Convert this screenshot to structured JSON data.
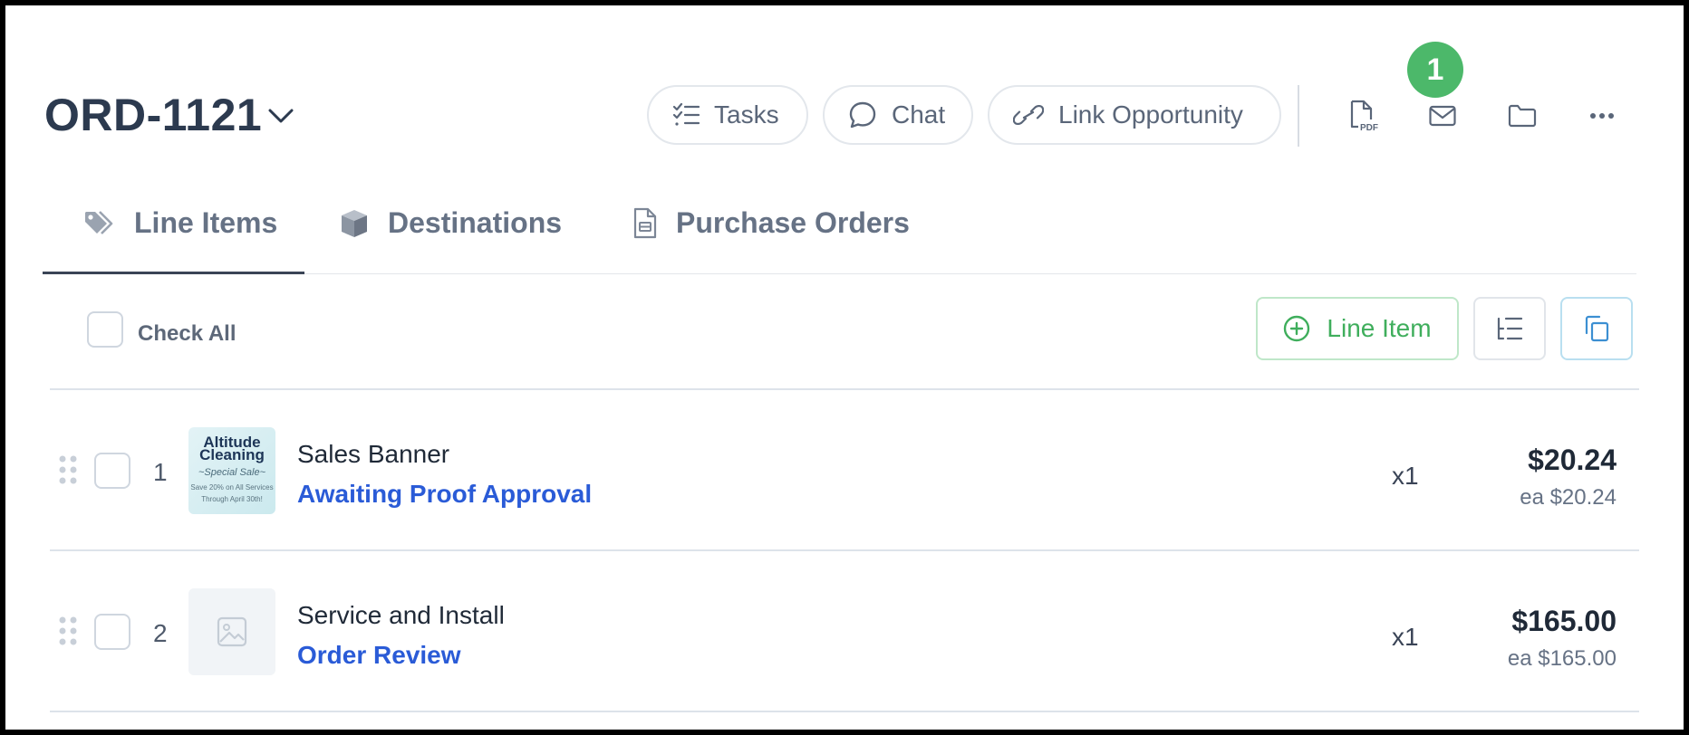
{
  "header": {
    "order_id": "ORD-1121",
    "actions": {
      "tasks": "Tasks",
      "chat": "Chat",
      "link_opportunity": "Link Opportunity"
    },
    "email_badge_count": "1"
  },
  "tabs": [
    {
      "label": "Line Items",
      "active": true
    },
    {
      "label": "Destinations",
      "active": false
    },
    {
      "label": "Purchase Orders",
      "active": false
    }
  ],
  "toolbar": {
    "check_all": "Check All",
    "add_line_item": "Line Item"
  },
  "line_items": [
    {
      "number": "1",
      "name": "Sales Banner",
      "status": "Awaiting Proof Approval",
      "quantity": "x1",
      "total": "$20.24",
      "unit_price": "ea $20.24",
      "thumbnail": {
        "line1": "Altitude",
        "line2": "Cleaning",
        "line3": "~Special Sale~",
        "line4": "Save 20% on All Services",
        "line5": "Through April 30th!"
      }
    },
    {
      "number": "2",
      "name": "Service and Install",
      "status": "Order Review",
      "quantity": "x1",
      "total": "$165.00",
      "unit_price": "ea $165.00",
      "thumbnail": null
    }
  ],
  "colors": {
    "accent_blue": "#2a5bd7",
    "success_green": "#4cb86a",
    "text_dark": "#2c3a4f"
  }
}
